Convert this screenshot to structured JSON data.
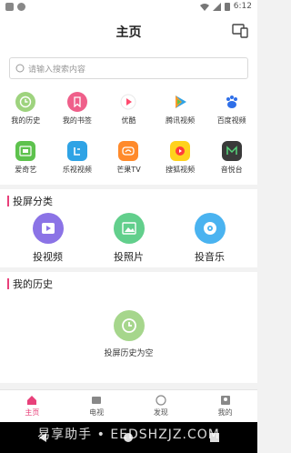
{
  "statusbar": {
    "time": "6:12"
  },
  "header": {
    "title": "主页"
  },
  "search": {
    "placeholder": "请输入搜索内容"
  },
  "apps": [
    {
      "label": "我的历史",
      "icon": "history-clock-icon",
      "color": "#9ed37e"
    },
    {
      "label": "我的书签",
      "icon": "bookmark-icon",
      "color": "#ef5f8a"
    },
    {
      "label": "优酷",
      "icon": "youku-play-icon",
      "color": "#ffffff"
    },
    {
      "label": "腾讯视频",
      "icon": "tencent-video-icon",
      "color": "#ffffff"
    },
    {
      "label": "百度视频",
      "icon": "baidu-paw-icon",
      "color": "#ffffff"
    },
    {
      "label": "爱奇艺",
      "icon": "iqiyi-icon",
      "color": "#5dc24d"
    },
    {
      "label": "乐视视频",
      "icon": "letv-icon",
      "color": "#2fa3e5"
    },
    {
      "label": "芒果TV",
      "icon": "mango-tv-icon",
      "color": "#ff8a2b"
    },
    {
      "label": "搜狐视频",
      "icon": "sohu-video-icon",
      "color": "#ffd21c"
    },
    {
      "label": "音悦台",
      "icon": "yinyuetai-icon",
      "color": "#3a3a3a"
    }
  ],
  "cast_section": {
    "title": "投屏分类",
    "items": [
      {
        "label": "投视频",
        "icon": "video-play-icon",
        "color": "#8b73e6"
      },
      {
        "label": "投照片",
        "icon": "photo-icon",
        "color": "#62cf8c"
      },
      {
        "label": "投音乐",
        "icon": "music-disc-icon",
        "color": "#4ab3f0"
      }
    ]
  },
  "history_section": {
    "title": "我的历史",
    "empty_text": "投屏历史为空"
  },
  "tabs": [
    {
      "label": "主页",
      "icon": "home-icon",
      "active": true
    },
    {
      "label": "电视",
      "icon": "tv-icon",
      "active": false
    },
    {
      "label": "发现",
      "icon": "discover-icon",
      "active": false
    },
    {
      "label": "我的",
      "icon": "profile-icon",
      "active": false
    }
  ],
  "watermark": "易享助手 • EEDSHZJZ.COM",
  "colors": {
    "accent": "#e8407a",
    "history_green": "#a6d68c"
  }
}
